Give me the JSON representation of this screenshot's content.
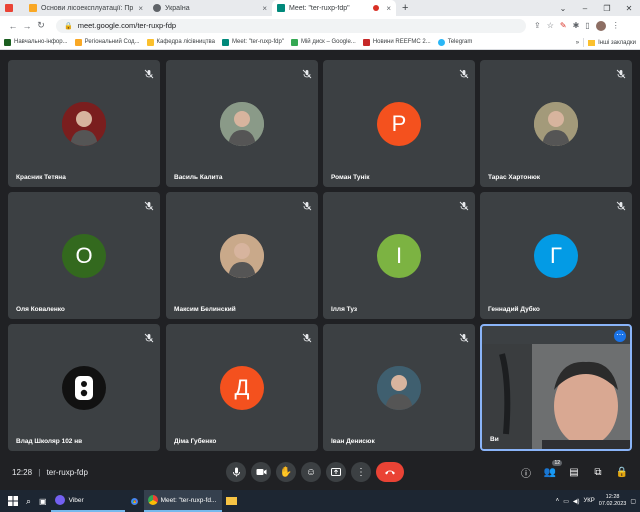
{
  "browser": {
    "tabs": [
      {
        "title": ""
      },
      {
        "title": "Основи лісоексплуатації: Пр"
      },
      {
        "title": "Україна"
      },
      {
        "title": "Meet: \"ter-ruxp-fdp\""
      }
    ],
    "url": "meet.google.com/ter-ruxp-fdp",
    "bookmarks": [
      {
        "label": "Навчально-інфор..."
      },
      {
        "label": "Регіональний Сод..."
      },
      {
        "label": "Кафедра лісівництва"
      },
      {
        "label": "Meet: \"ter-ruxp-fdp\""
      },
      {
        "label": "Мій диск – Google..."
      },
      {
        "label": "Новини REEFMC 2..."
      },
      {
        "label": "Telegram"
      }
    ],
    "other_bookmarks": "Інші закладки"
  },
  "meet": {
    "participants": [
      {
        "name": "Красник Тетяна",
        "kind": "photo",
        "color": "#7a1e1e"
      },
      {
        "name": "Василь Калита",
        "kind": "photo",
        "color": "#8a9a88"
      },
      {
        "name": "Роман Тунік",
        "kind": "letter",
        "letter": "Р",
        "color": "#f4511e"
      },
      {
        "name": "Тарас Хартонюк",
        "kind": "photo",
        "color": "#a39a7a"
      },
      {
        "name": "Оля Коваленко",
        "kind": "letter",
        "letter": "О",
        "color": "#33691e"
      },
      {
        "name": "Максим Белинский",
        "kind": "photo",
        "color": "#c9a98a"
      },
      {
        "name": "Ілля Туз",
        "kind": "letter",
        "letter": "І",
        "color": "#7cb342"
      },
      {
        "name": "Геннадий Дубко",
        "kind": "letter",
        "letter": "Г",
        "color": "#039be5"
      },
      {
        "name": "Влад Школяр 102 нв",
        "kind": "logo",
        "color": "#111111"
      },
      {
        "name": "Діма Губенко",
        "kind": "letter",
        "letter": "Д",
        "color": "#f4511e"
      },
      {
        "name": "Іван Денисюк",
        "kind": "photo",
        "color": "#3f5f6f"
      },
      {
        "name": "Ви",
        "kind": "self",
        "color": "#5a5c5e"
      }
    ],
    "time": "12:28",
    "meeting_code": "ter-ruxp-fdp",
    "people_count": "12"
  },
  "taskbar": {
    "viber_label": "Viber",
    "meet_label": "Meet: \"ter-ruxp-fd...",
    "lang": "УКР",
    "clock_time": "12:28",
    "clock_date": "07.02.2023"
  }
}
